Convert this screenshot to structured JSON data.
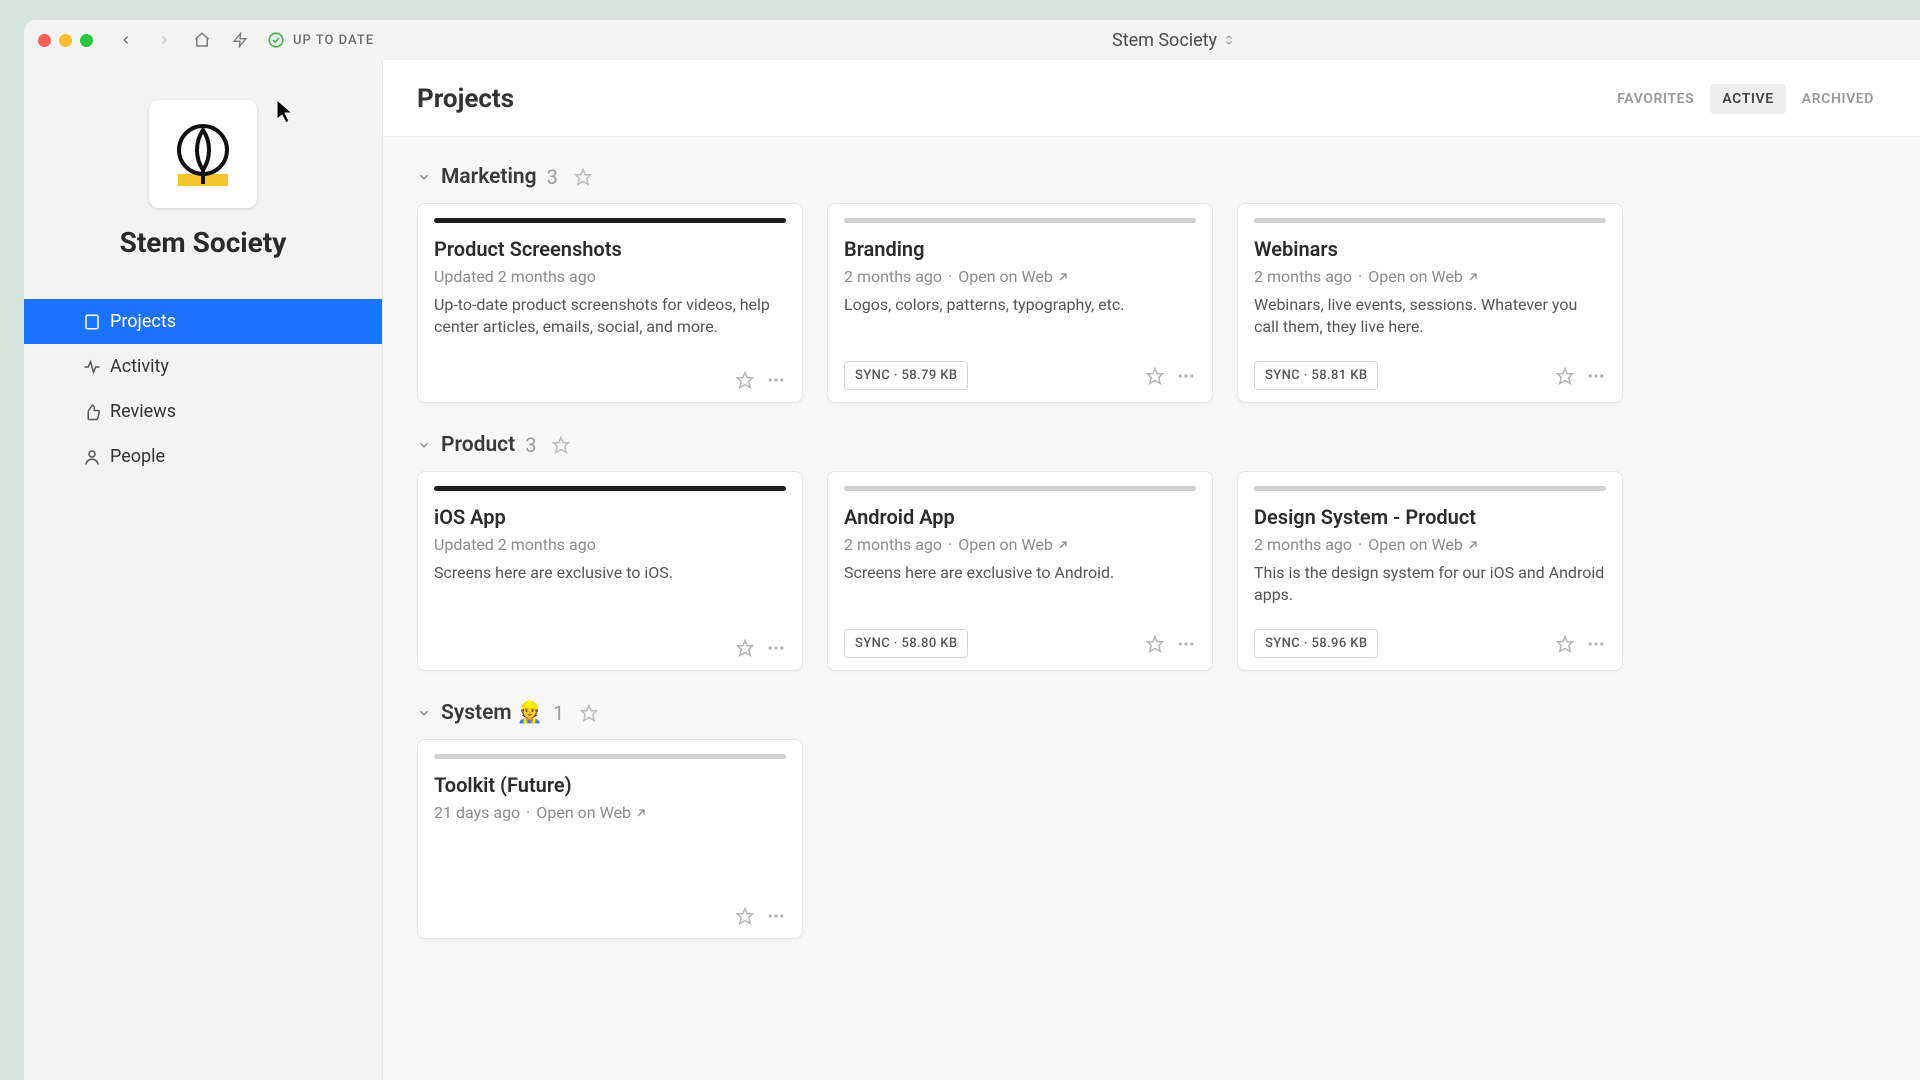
{
  "titlebar": {
    "status": "UP TO DATE",
    "workspace": "Stem Society"
  },
  "brand": {
    "name": "Stem Society"
  },
  "sidebar": {
    "items": [
      {
        "label": "Projects"
      },
      {
        "label": "Activity"
      },
      {
        "label": "Reviews"
      },
      {
        "label": "People"
      }
    ]
  },
  "page": {
    "title": "Projects",
    "tabs": [
      {
        "label": "FAVORITES"
      },
      {
        "label": "ACTIVE"
      },
      {
        "label": "ARCHIVED"
      }
    ]
  },
  "sections": [
    {
      "name": "Marketing",
      "count": "3",
      "cards": [
        {
          "title": "Product Screenshots",
          "sub_prefix": "Updated ",
          "time": "2 months ago",
          "open_web": false,
          "desc": "Up-to-date product screenshots for videos, help center articles, emails, social, and more.",
          "sync": null,
          "dark": true
        },
        {
          "title": "Branding",
          "sub_prefix": "",
          "time": "2 months ago",
          "open_web": true,
          "desc": "Logos, colors, patterns, typography, etc.",
          "sync": "SYNC · 58.79 KB",
          "dark": false
        },
        {
          "title": "Webinars",
          "sub_prefix": "",
          "time": "2 months ago",
          "open_web": true,
          "desc": "Webinars, live events, sessions. Whatever you call them, they live here.",
          "sync": "SYNC · 58.81 KB",
          "dark": false
        }
      ]
    },
    {
      "name": "Product",
      "count": "3",
      "cards": [
        {
          "title": "iOS App",
          "sub_prefix": "Updated ",
          "time": "2 months ago",
          "open_web": false,
          "desc": "Screens here are exclusive to iOS.",
          "sync": null,
          "dark": true
        },
        {
          "title": "Android App",
          "sub_prefix": "",
          "time": "2 months ago",
          "open_web": true,
          "desc": "Screens here are exclusive to Android.",
          "sync": "SYNC · 58.80 KB",
          "dark": false
        },
        {
          "title": "Design System - Product",
          "sub_prefix": "",
          "time": "2 months ago",
          "open_web": true,
          "desc": "This is the design system for our iOS and Android apps.",
          "sync": "SYNC · 58.96 KB",
          "dark": false
        }
      ]
    },
    {
      "name": "System 👷",
      "count": "1",
      "cards": [
        {
          "title": "Toolkit (Future)",
          "sub_prefix": "",
          "time": "21 days ago",
          "open_web": true,
          "desc": "",
          "sync": null,
          "dark": false
        }
      ]
    }
  ],
  "labels": {
    "open_on_web": "Open on Web"
  }
}
